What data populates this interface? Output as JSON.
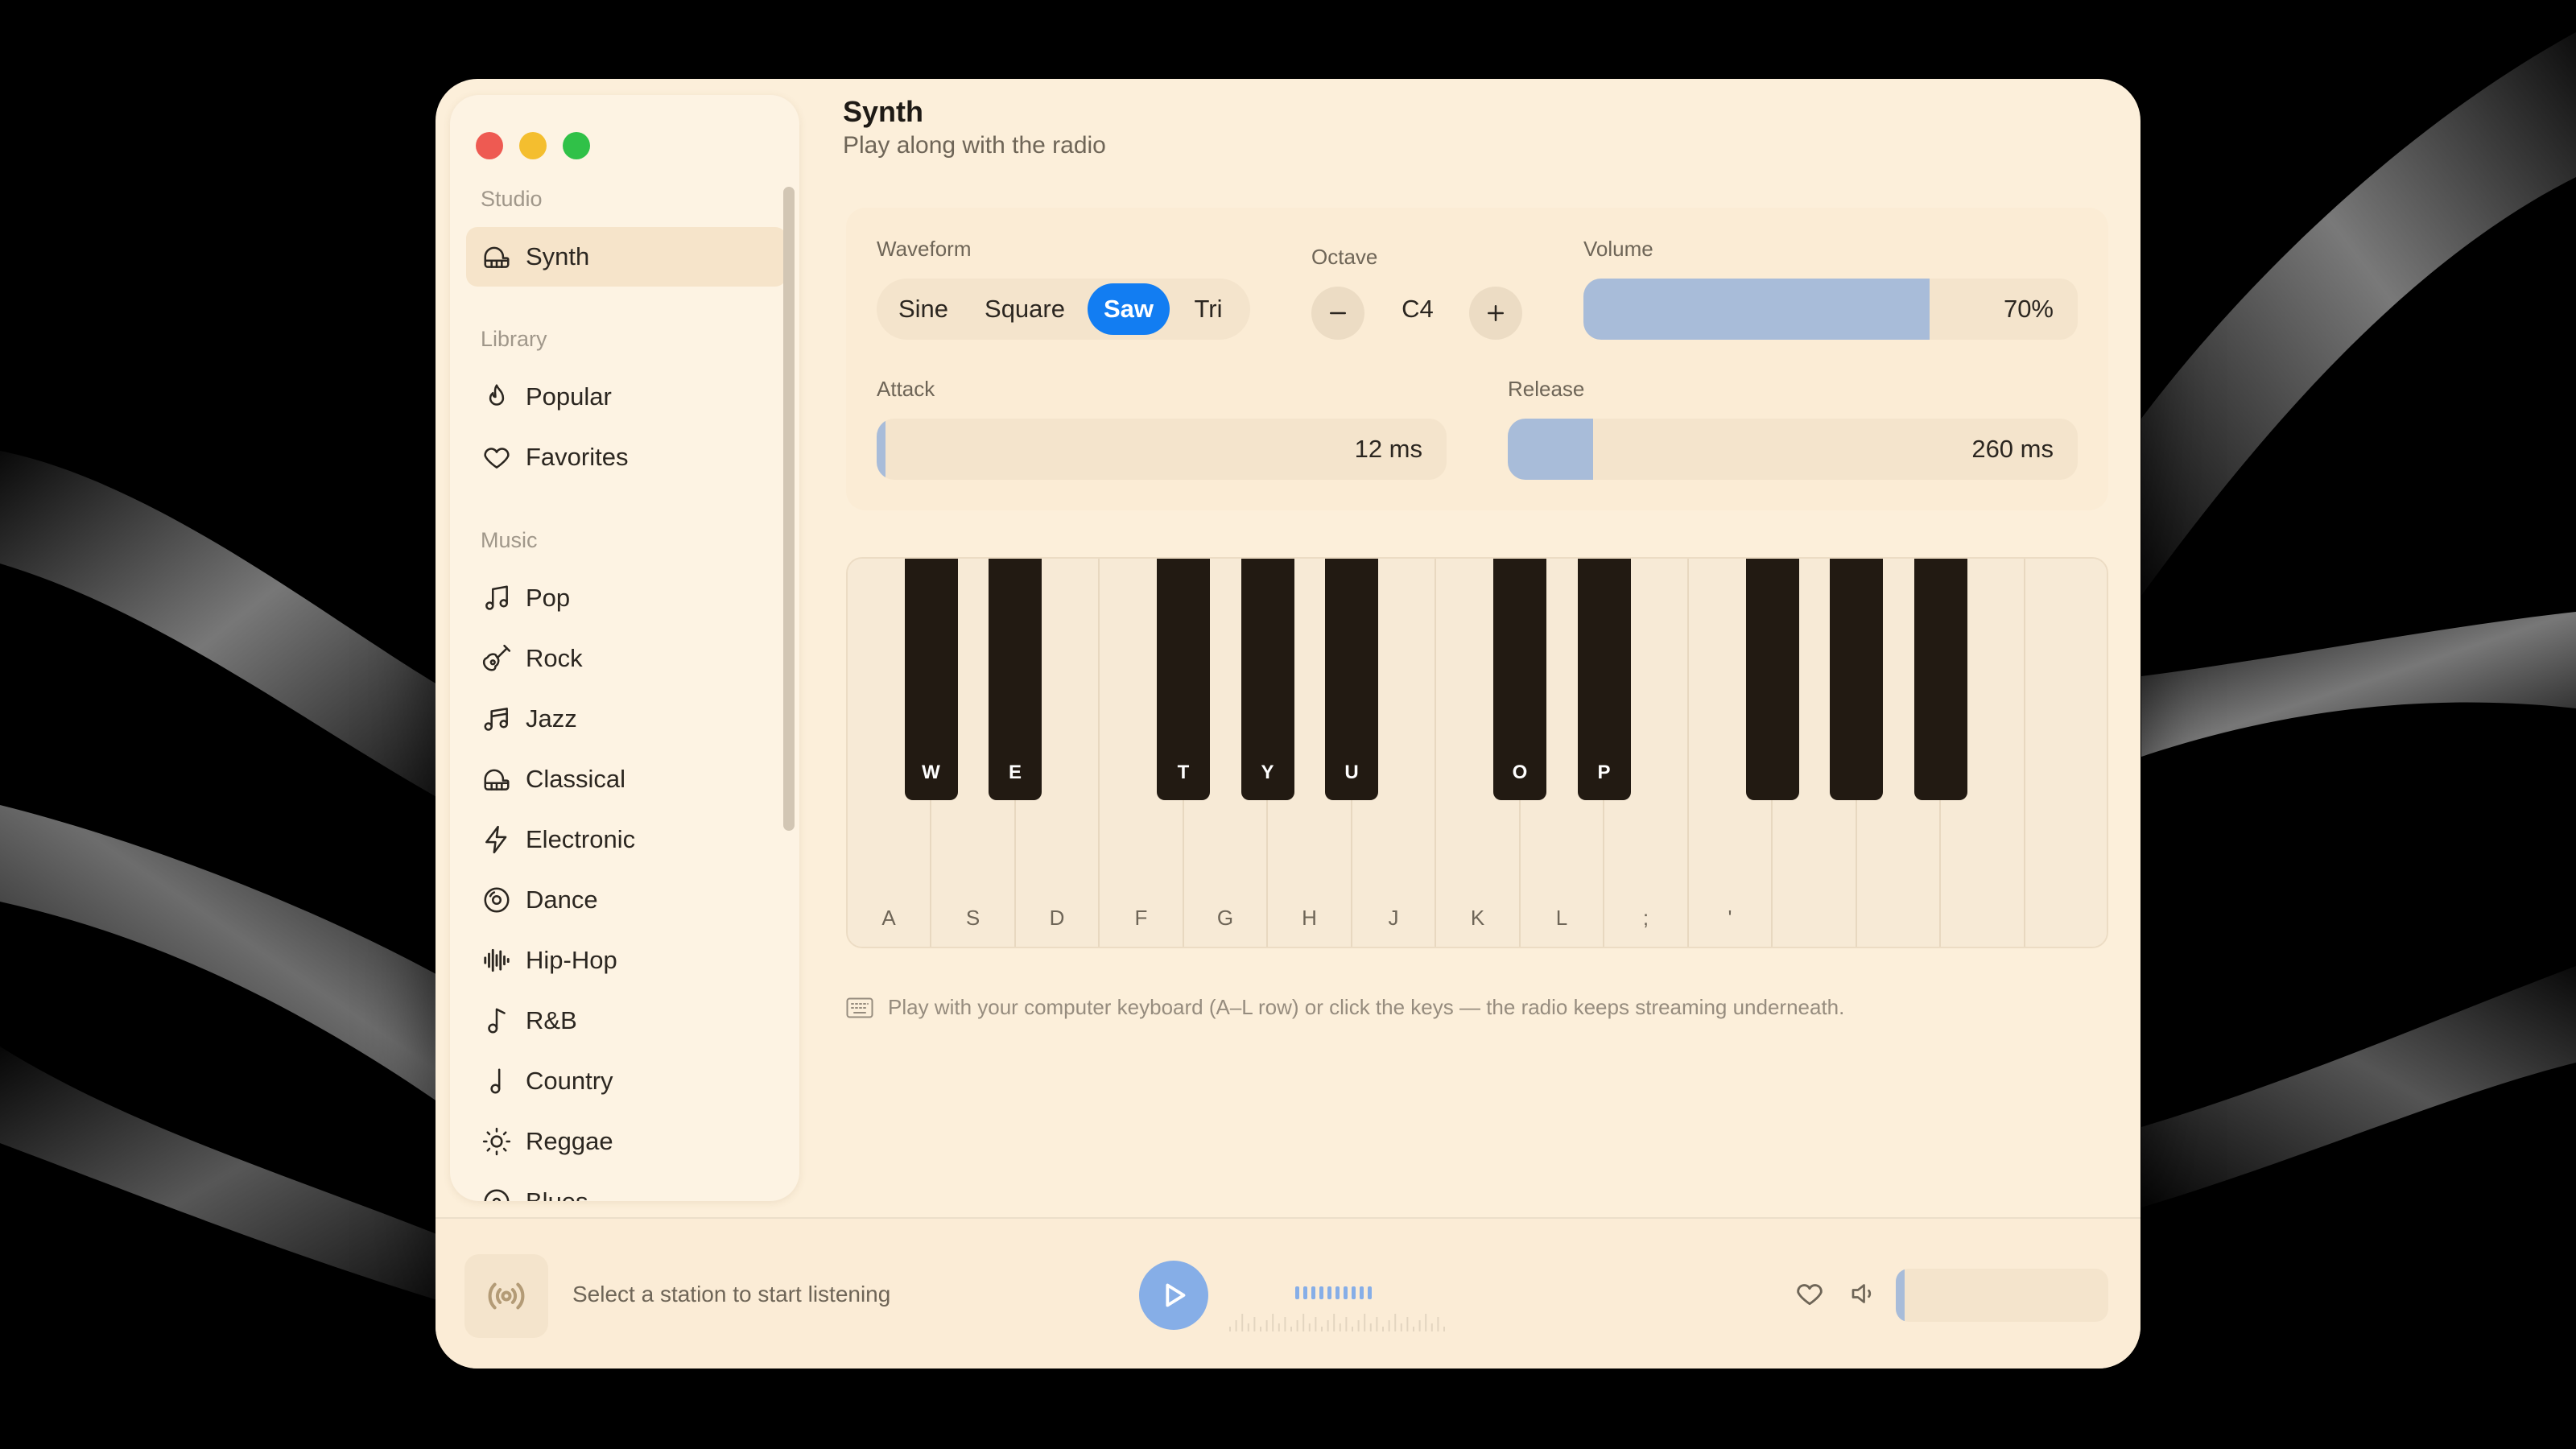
{
  "sidebar": {
    "sections": [
      {
        "label": "Studio",
        "items": [
          {
            "label": "Synth",
            "icon": "piano-icon",
            "active": true
          }
        ]
      },
      {
        "label": "Library",
        "items": [
          {
            "label": "Popular",
            "icon": "flame-icon"
          },
          {
            "label": "Favorites",
            "icon": "heart-icon"
          }
        ]
      },
      {
        "label": "Music",
        "items": [
          {
            "label": "Pop",
            "icon": "music-notes-icon"
          },
          {
            "label": "Rock",
            "icon": "guitar-icon"
          },
          {
            "label": "Jazz",
            "icon": "music-notes-icon"
          },
          {
            "label": "Classical",
            "icon": "piano-icon"
          },
          {
            "label": "Electronic",
            "icon": "lightning-icon"
          },
          {
            "label": "Dance",
            "icon": "disc-icon"
          },
          {
            "label": "Hip-Hop",
            "icon": "waveform-icon"
          },
          {
            "label": "R&B",
            "icon": "music-note-icon"
          },
          {
            "label": "Country",
            "icon": "music-note-icon"
          },
          {
            "label": "Reggae",
            "icon": "sun-icon"
          },
          {
            "label": "Blues",
            "icon": "disc-icon"
          }
        ]
      }
    ]
  },
  "header": {
    "title": "Synth",
    "subtitle": "Play along with the radio"
  },
  "controls": {
    "waveform": {
      "label": "Waveform",
      "options": [
        "Sine",
        "Square",
        "Saw",
        "Tri"
      ],
      "selected": "Saw"
    },
    "octave": {
      "label": "Octave",
      "value": "C4"
    },
    "volume": {
      "label": "Volume",
      "value_text": "70%",
      "level": 0.7
    },
    "attack": {
      "label": "Attack",
      "value_text": "12 ms",
      "level": 0.012
    },
    "release": {
      "label": "Release",
      "value_text": "260 ms",
      "level": 0.15
    }
  },
  "piano": {
    "white_keys": [
      "A",
      "S",
      "D",
      "F",
      "G",
      "H",
      "J",
      "K",
      "L",
      ";",
      "'",
      "",
      "",
      "",
      ""
    ],
    "black_keys": [
      {
        "label": "W"
      },
      {
        "label": "E"
      },
      {
        "label": "T"
      },
      {
        "label": "Y"
      },
      {
        "label": "U"
      },
      {
        "label": "O"
      },
      {
        "label": "P"
      },
      {
        "label": ""
      },
      {
        "label": ""
      },
      {
        "label": ""
      }
    ]
  },
  "hint": "Play with your computer keyboard (A–L row) or click the keys — the radio keeps streaming underneath.",
  "player": {
    "station_text": "Select a station to start listening",
    "volume_level": 0.04
  },
  "colors": {
    "accent": "#127df2",
    "background": "#fcefda",
    "black_key": "#221a12",
    "slider_fill": "#a8bcd9"
  }
}
